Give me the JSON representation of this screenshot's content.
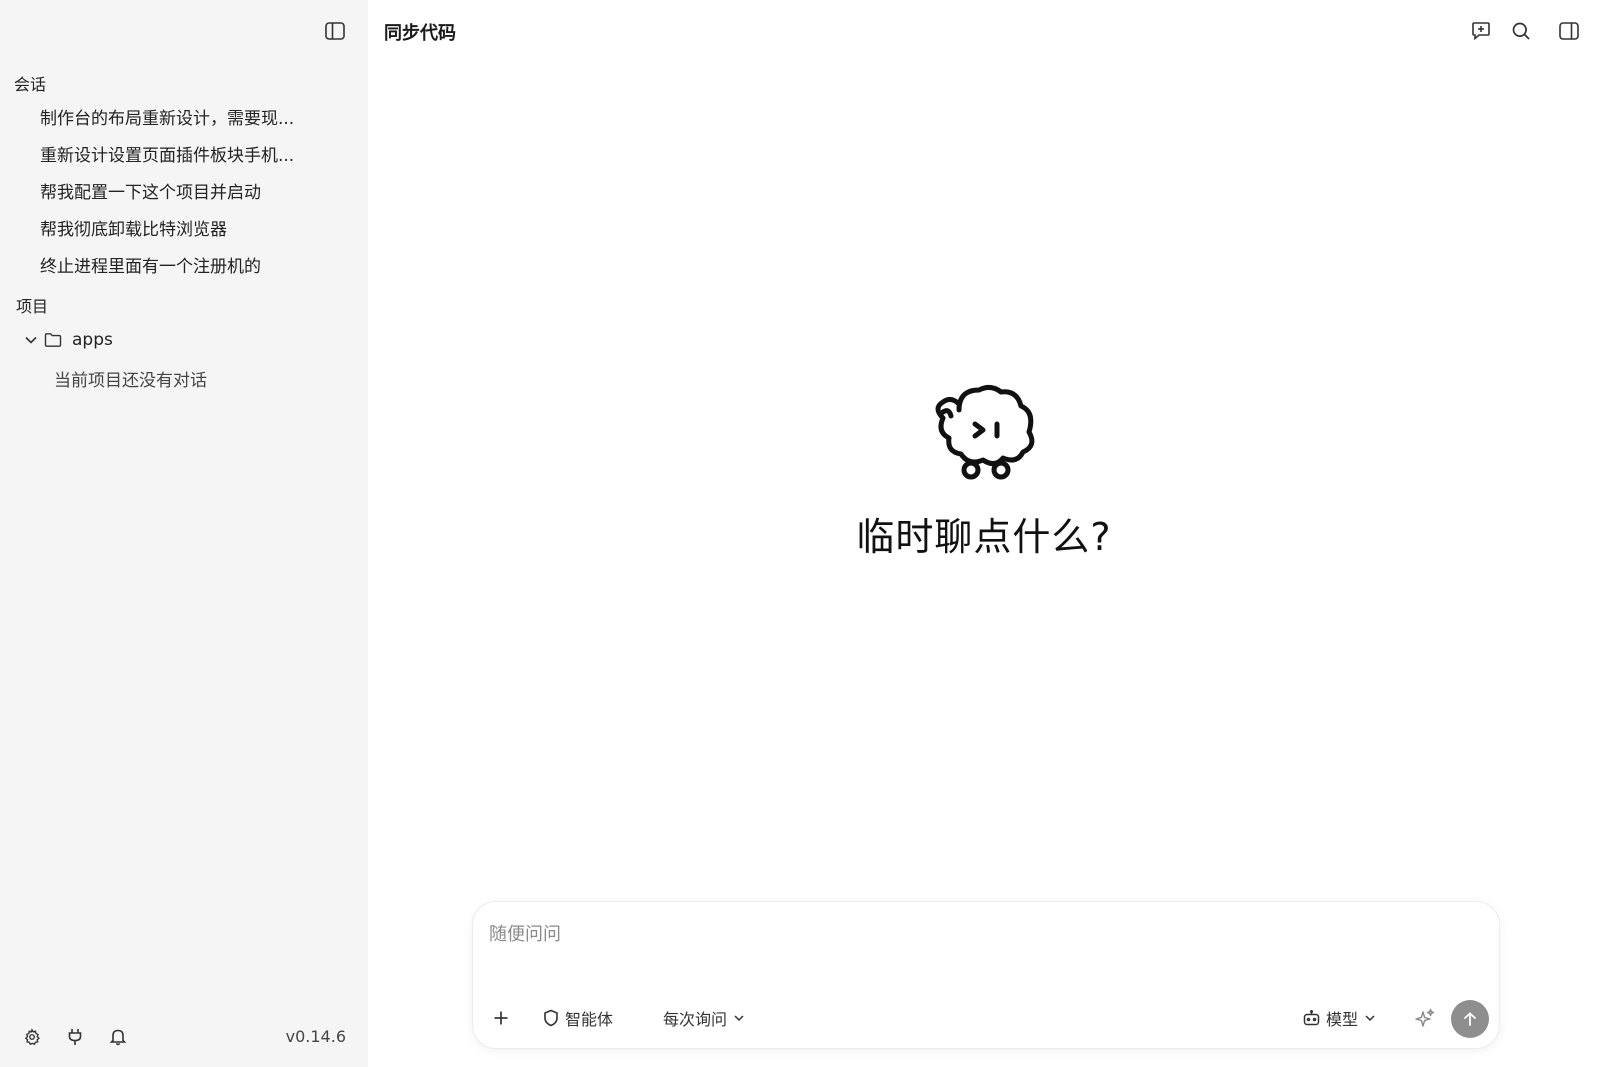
{
  "sidebar": {
    "conversations_label": "会话",
    "conversations": [
      "制作台的布局重新设计，需要现...",
      "重新设计设置页面插件板块手机...",
      "帮我配置一下这个项目并启动",
      "帮我彻底卸载比特浏览器",
      "终止进程里面有一个注册机的"
    ],
    "projects_label": "项目",
    "project": {
      "name": "apps",
      "empty_text": "当前项目还没有对话"
    },
    "version": "v0.14.6"
  },
  "main": {
    "title": "同步代码",
    "hero_title": "临时聊点什么?",
    "composer": {
      "placeholder": "随便问问",
      "agent_label": "智能体",
      "ask_mode_label": "每次询问",
      "model_label": "模型"
    }
  },
  "colors": {
    "sidebar_bg": "#f5f5f5",
    "send_button": "#8e8e8e"
  }
}
